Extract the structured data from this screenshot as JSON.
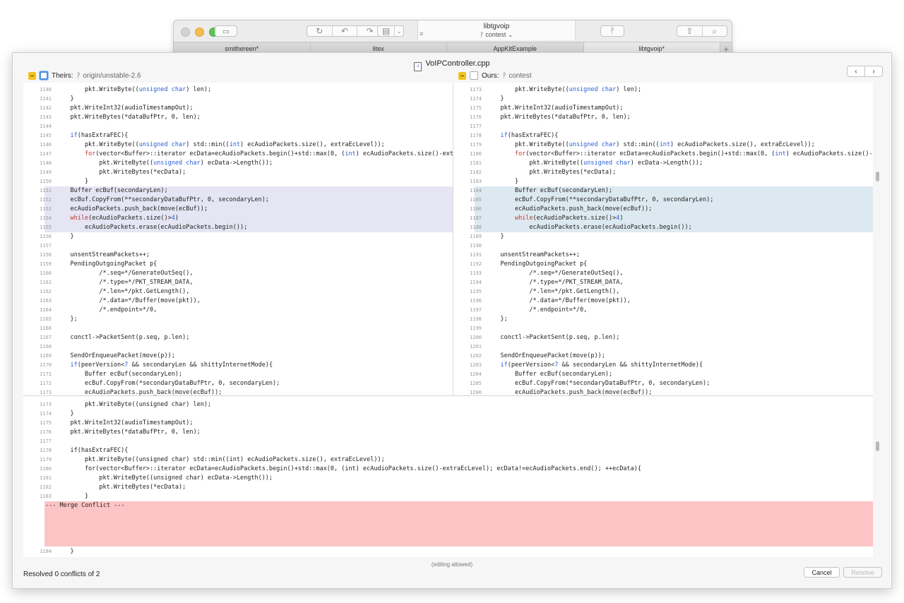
{
  "window": {
    "repo": "libtgvoip",
    "branch": "ᚹ contest ⌄",
    "tabs": [
      "smithereen*",
      "litex",
      "AppKitExample",
      "libtgvoip*"
    ],
    "toolbar_icons": [
      "sidebar-icon",
      "fetch-icon",
      "pull-icon",
      "push-icon",
      "stash-icon",
      "branch-icon",
      "share-icon",
      "search-icon"
    ]
  },
  "merge": {
    "file": "VoIPController.cpp",
    "theirs_label": "Theirs:",
    "theirs_branch": "ᚹ origin/unstable-2.6",
    "ours_label": "Ours:",
    "ours_branch": "ᚹ contest",
    "prev": "‹",
    "next": "›",
    "editing_note": "(editing allowed)",
    "status": "Resolved 0 conflicts of 2",
    "cancel": "Cancel",
    "resolve": "Resolve",
    "conflict_marker": "--- Merge Conflict ---",
    "colors": {
      "theirs_highlight": "#e5e5f3",
      "ours_highlight": "#dde9f0",
      "conflict": "#fcc4c4"
    }
  },
  "left_pane": [
    {
      "n": "1140",
      "t": "        pkt.WriteByte((<k>unsigned</k> <k>char</k>) len);"
    },
    {
      "n": "1141",
      "t": "    }"
    },
    {
      "n": "1142",
      "t": "    pkt.WriteInt32(audioTimestampOut);"
    },
    {
      "n": "1143",
      "t": "    pkt.WriteBytes(*dataBufPtr, 0, len);"
    },
    {
      "n": "1144",
      "t": ""
    },
    {
      "n": "1145",
      "t": "    <k>if</k>(hasExtraFEC){"
    },
    {
      "n": "1146",
      "t": "        pkt.WriteByte((<k>unsigned</k> <k>char</k>) std::min((<k>int</k>) ecAudioPackets.size(), extraEcLevel));"
    },
    {
      "n": "1147",
      "t": "        <r>for</r>(vector<Buffer>::iterator ecData=ecAudioPackets.begin()+std::max(0, (<k>int</k>) ecAudioPackets.size()-extraEcLevel); ecData!=ecAudioPackets.end(); ++ecData){"
    },
    {
      "n": "1148",
      "t": "            pkt.WriteByte((<k>unsigned</k> <k>char</k>) ecData->Length());"
    },
    {
      "n": "1149",
      "t": "            pkt.WriteBytes(*ecData);"
    },
    {
      "n": "1150",
      "t": "        }"
    },
    {
      "n": "1151",
      "t": "    Buffer ecBuf(secondaryLen);",
      "h": 1
    },
    {
      "n": "1152",
      "t": "    ecBuf.CopyFrom(**secondaryDataBufPtr, 0, secondaryLen);",
      "h": 1
    },
    {
      "n": "1153",
      "t": "    ecAudioPackets.push_back(move(ecBuf));",
      "h": 1
    },
    {
      "n": "1154",
      "t": "    <r>while</r>(ecAudioPackets.size()><k>4</k>)",
      "h": 1
    },
    {
      "n": "1155",
      "t": "        ecAudioPackets.erase(ecAudioPackets.begin());",
      "h": 1
    },
    {
      "n": "1156",
      "t": "    }"
    },
    {
      "n": "1157",
      "t": ""
    },
    {
      "n": "1158",
      "t": "    unsentStreamPackets++;"
    },
    {
      "n": "1159",
      "t": "    PendingOutgoingPacket p{"
    },
    {
      "n": "1160",
      "t": "            /*.seq=*/GenerateOutSeq(),"
    },
    {
      "n": "1161",
      "t": "            /*.type=*/PKT_STREAM_DATA,"
    },
    {
      "n": "1162",
      "t": "            /*.len=*/pkt.GetLength(),"
    },
    {
      "n": "1163",
      "t": "            /*.data=*/Buffer(move(pkt)),"
    },
    {
      "n": "1164",
      "t": "            /*.endpoint=*/0,"
    },
    {
      "n": "1165",
      "t": "    };"
    },
    {
      "n": "1166",
      "t": ""
    },
    {
      "n": "1167",
      "t": "    conctl->PacketSent(p.seq, p.len);"
    },
    {
      "n": "1168",
      "t": ""
    },
    {
      "n": "1169",
      "t": "    SendOrEnqueuePacket(move(p));"
    },
    {
      "n": "1170",
      "t": "    <k>if</k>(peerVersion<<k>7</k> && secondaryLen && shittyInternetMode){"
    },
    {
      "n": "1171",
      "t": "        Buffer ecBuf(secondaryLen);"
    },
    {
      "n": "1172",
      "t": "        ecBuf.CopyFrom(*secondaryDataBufPtr, 0, secondaryLen);"
    },
    {
      "n": "1173",
      "t": "        ecAudioPackets.push_back(move(ecBuf));"
    }
  ],
  "right_pane": [
    {
      "n": "1173",
      "t": "        pkt.WriteByte((<k>unsigned</k> <k>char</k>) len);"
    },
    {
      "n": "1174",
      "t": "    }"
    },
    {
      "n": "1175",
      "t": "    pkt.WriteInt32(audioTimestampOut);"
    },
    {
      "n": "1176",
      "t": "    pkt.WriteBytes(*dataBufPtr, 0, len);"
    },
    {
      "n": "1177",
      "t": ""
    },
    {
      "n": "1178",
      "t": "    <k>if</k>(hasExtraFEC){"
    },
    {
      "n": "1179",
      "t": "        pkt.WriteByte((<k>unsigned</k> <k>char</k>) std::min((<k>int</k>) ecAudioPackets.size(), extraEcLevel));"
    },
    {
      "n": "1180",
      "t": "        <r>for</r>(vector<Buffer>::iterator ecData=ecAudioPackets.begin()+std::max(0, (<k>int</k>) ecAudioPackets.size()-extraEcLevel); ecData!=ecAudioPackets.end(); ++ecData){"
    },
    {
      "n": "1181",
      "t": "            pkt.WriteByte((<k>unsigned</k> <k>char</k>) ecData->Length());"
    },
    {
      "n": "1182",
      "t": "            pkt.WriteBytes(*ecData);"
    },
    {
      "n": "1183",
      "t": "        }"
    },
    {
      "n": "1184",
      "t": "        Buffer ecBuf(secondaryLen);",
      "h": 1
    },
    {
      "n": "1185",
      "t": "        ecBuf.CopyFrom(**secondaryDataBufPtr, 0, secondaryLen);",
      "h": 1
    },
    {
      "n": "1186",
      "t": "        ecAudioPackets.push_back(move(ecBuf));",
      "h": 1
    },
    {
      "n": "1187",
      "t": "        <r>while</r>(ecAudioPackets.size()><k>4</k>)",
      "h": 1
    },
    {
      "n": "1188",
      "t": "            ecAudioPackets.erase(ecAudioPackets.begin());",
      "h": 1
    },
    {
      "n": "1189",
      "t": "    }"
    },
    {
      "n": "1190",
      "t": ""
    },
    {
      "n": "1191",
      "t": "    unsentStreamPackets++;"
    },
    {
      "n": "1192",
      "t": "    PendingOutgoingPacket p{"
    },
    {
      "n": "1193",
      "t": "            /*.seq=*/GenerateOutSeq(),"
    },
    {
      "n": "1194",
      "t": "            /*.type=*/PKT_STREAM_DATA,"
    },
    {
      "n": "1195",
      "t": "            /*.len=*/pkt.GetLength(),"
    },
    {
      "n": "1196",
      "t": "            /*.data=*/Buffer(move(pkt)),"
    },
    {
      "n": "1197",
      "t": "            /*.endpoint=*/0,"
    },
    {
      "n": "1198",
      "t": "    };"
    },
    {
      "n": "1199",
      "t": ""
    },
    {
      "n": "1200",
      "t": "    conctl->PacketSent(p.seq, p.len);"
    },
    {
      "n": "1201",
      "t": ""
    },
    {
      "n": "1202",
      "t": "    SendOrEnqueuePacket(move(p));"
    },
    {
      "n": "1203",
      "t": "    <k>if</k>(peerVersion<<k>7</k> && secondaryLen && shittyInternetMode){"
    },
    {
      "n": "1204",
      "t": "        Buffer ecBuf(secondaryLen);"
    },
    {
      "n": "1205",
      "t": "        ecBuf.CopyFrom(*secondaryDataBufPtr, 0, secondaryLen);"
    },
    {
      "n": "1206",
      "t": "        ecAudioPackets.push_back(move(ecBuf));"
    }
  ],
  "bottom_pane": [
    {
      "n": "1173",
      "t": "        pkt.WriteByte((unsigned char) len);"
    },
    {
      "n": "1174",
      "t": "    }"
    },
    {
      "n": "1175",
      "t": "    pkt.WriteInt32(audioTimestampOut);"
    },
    {
      "n": "1176",
      "t": "    pkt.WriteBytes(*dataBufPtr, 0, len);"
    },
    {
      "n": "1177",
      "t": ""
    },
    {
      "n": "1178",
      "t": "    if(hasExtraFEC){"
    },
    {
      "n": "1179",
      "t": "        pkt.WriteByte((unsigned char) std::min((int) ecAudioPackets.size(), extraEcLevel));"
    },
    {
      "n": "1180",
      "t": "        for(vector<Buffer>::iterator ecData=ecAudioPackets.begin()+std::max(0, (int) ecAudioPackets.size()-extraEcLevel); ecData!=ecAudioPackets.end(); ++ecData){"
    },
    {
      "n": "1181",
      "t": "            pkt.WriteByte((unsigned char) ecData->Length());"
    },
    {
      "n": "1182",
      "t": "            pkt.WriteBytes(*ecData);"
    },
    {
      "n": "1183",
      "t": "        }"
    }
  ],
  "bottom_after": {
    "n": "1184",
    "t": "    }"
  }
}
